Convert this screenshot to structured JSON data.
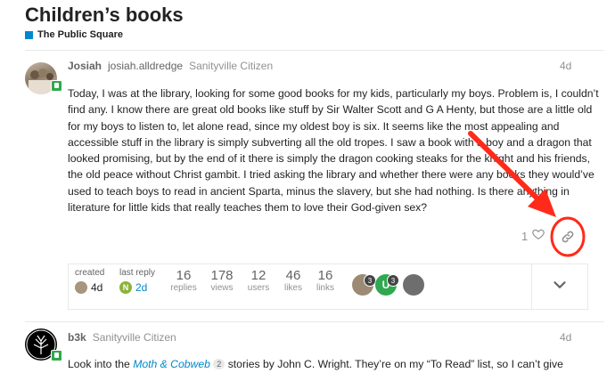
{
  "topic": {
    "title": "Children’s books",
    "category": "The Public Square",
    "category_color": "#0088cc"
  },
  "post1": {
    "username": "Josiah",
    "fullname": "josiah.alldredge",
    "user_title": "Sanityville Citizen",
    "date": "4d",
    "body": "Today, I was at the library, looking for some good books for my kids, particularly my boys. Problem is, I couldn’t find any. I know there are great old books like stuff by Sir Walter Scott and G A Henty, but those are a little old for my boys to listen to, let alone read, since my oldest boy is six. It seems like the most appealing and accessible stuff in the library is simply subverting all the old tropes. I saw a book with a boy and a dragon that looked promising, but by the end of it there is simply the dragon cooking steaks for the knight and his friends, the old peace without Christ gambit. I tried asking the library and whether there were any books they would’ve used to teach boys to read in ancient Sparta, minus the slavery, but she had nothing. Is there anything in literature for little kids that really teaches them to love their God-given sex?",
    "like_count": "1",
    "icons": {
      "like": "heart-icon",
      "share": "link-icon"
    }
  },
  "topic_map": {
    "created_label": "created",
    "created_date": "4d",
    "last_reply_label": "last reply",
    "last_reply_initial": "N",
    "last_reply_color": "#8db23b",
    "last_reply_date": "2d",
    "stats": [
      {
        "value": "16",
        "label": "replies"
      },
      {
        "value": "178",
        "label": "views"
      },
      {
        "value": "12",
        "label": "users"
      },
      {
        "value": "46",
        "label": "likes"
      },
      {
        "value": "16",
        "label": "links"
      }
    ],
    "participants": [
      {
        "count": "3"
      },
      {
        "initial": "U",
        "count": "3",
        "color": "#2fa84f"
      },
      {}
    ]
  },
  "post2": {
    "username": "b3k",
    "user_title": "Sanityville Citizen",
    "date": "4d",
    "body_prefix": "Look into the ",
    "link_text": "Moth & Cobweb",
    "link_badge": "2",
    "body_suffix": " stories by John C. Wright. They’re on my “To Read” list, so I can’t give"
  },
  "annotation_color": "#ff2a1a"
}
